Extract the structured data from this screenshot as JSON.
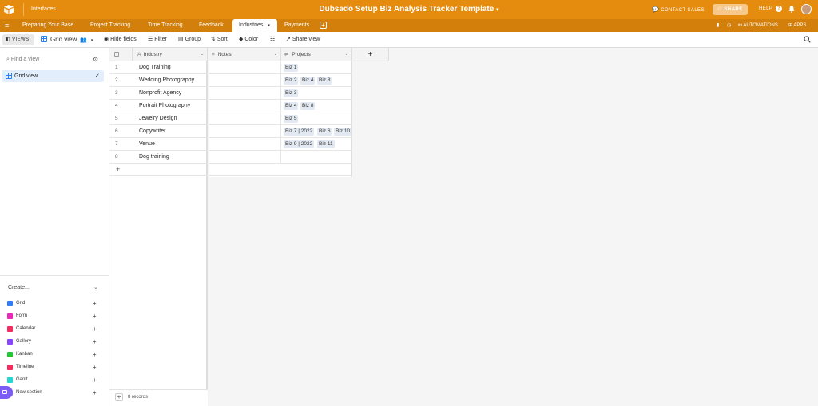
{
  "topbar": {
    "interfaces_label": "Interfaces",
    "base_title": "Dubsado Setup Biz Analysis Tracker Template",
    "base_title_caret": "▾",
    "contact_sales": "CONTACT SALES",
    "share": "SHARE",
    "help": "HELP",
    "help_q": "?",
    "bg_color": "#e58c0f"
  },
  "tabs": {
    "items": [
      {
        "label": "Preparing Your Base"
      },
      {
        "label": "Project Tracking"
      },
      {
        "label": "Time Tracking"
      },
      {
        "label": "Feedback"
      },
      {
        "label": "Industries"
      },
      {
        "label": "Payments"
      }
    ],
    "active_caret": "▾",
    "add": "+",
    "automations": "AUTOMATIONS",
    "apps": "APPS"
  },
  "toolbar": {
    "views": "VIEWS",
    "grid_view": "Grid view",
    "hide_fields": "Hide fields",
    "filter": "Filter",
    "group": "Group",
    "sort": "Sort",
    "color": "Color",
    "share_view": "Share view"
  },
  "sidebar": {
    "find_placeholder": "Find a view",
    "gear": "⚙",
    "current_view": "Grid view",
    "check": "✓",
    "create": "Create...",
    "create_chevron": "⌄",
    "plus": "+",
    "create_items": [
      {
        "label": "Grid",
        "color": "#2d7ff9"
      },
      {
        "label": "Form",
        "color": "#e929ba"
      },
      {
        "label": "Calendar",
        "color": "#f82b60"
      },
      {
        "label": "Gallery",
        "color": "#8b46ff"
      },
      {
        "label": "Kanban",
        "color": "#20c933"
      },
      {
        "label": "Timeline",
        "color": "#f82b60"
      },
      {
        "label": "Gantt",
        "color": "#20d9d2"
      },
      {
        "label": "New section",
        "color": "#999999"
      }
    ]
  },
  "grid": {
    "columns": [
      {
        "label": "Industry",
        "icon": "A"
      },
      {
        "label": "Notes",
        "icon": "≡"
      },
      {
        "label": "Projects",
        "icon": "⇌"
      }
    ],
    "add_field": "+",
    "add_row": "+",
    "header_chevron": "⌄",
    "rows": [
      {
        "num": "1",
        "industry": "Dog Training",
        "projects": [
          "Biz 1"
        ]
      },
      {
        "num": "2",
        "industry": "Wedding Photography",
        "projects": [
          "Biz 2",
          "Biz 4",
          "Biz 8"
        ]
      },
      {
        "num": "3",
        "industry": "Nonprofit Agency",
        "projects": [
          "Biz 3"
        ]
      },
      {
        "num": "4",
        "industry": "Portrait Photography",
        "projects": [
          "Biz 4",
          "Biz 8"
        ]
      },
      {
        "num": "5",
        "industry": "Jewelry Design",
        "projects": [
          "Biz 5"
        ]
      },
      {
        "num": "6",
        "industry": "Copywriter",
        "projects": [
          "Biz 7 | 2022",
          "Biz 6",
          "Biz 10"
        ]
      },
      {
        "num": "7",
        "industry": "Venue",
        "projects": [
          "Biz 9 | 2022",
          "Biz 11"
        ]
      },
      {
        "num": "8",
        "industry": "Dog training",
        "projects": []
      }
    ],
    "record_count": "8 records"
  }
}
